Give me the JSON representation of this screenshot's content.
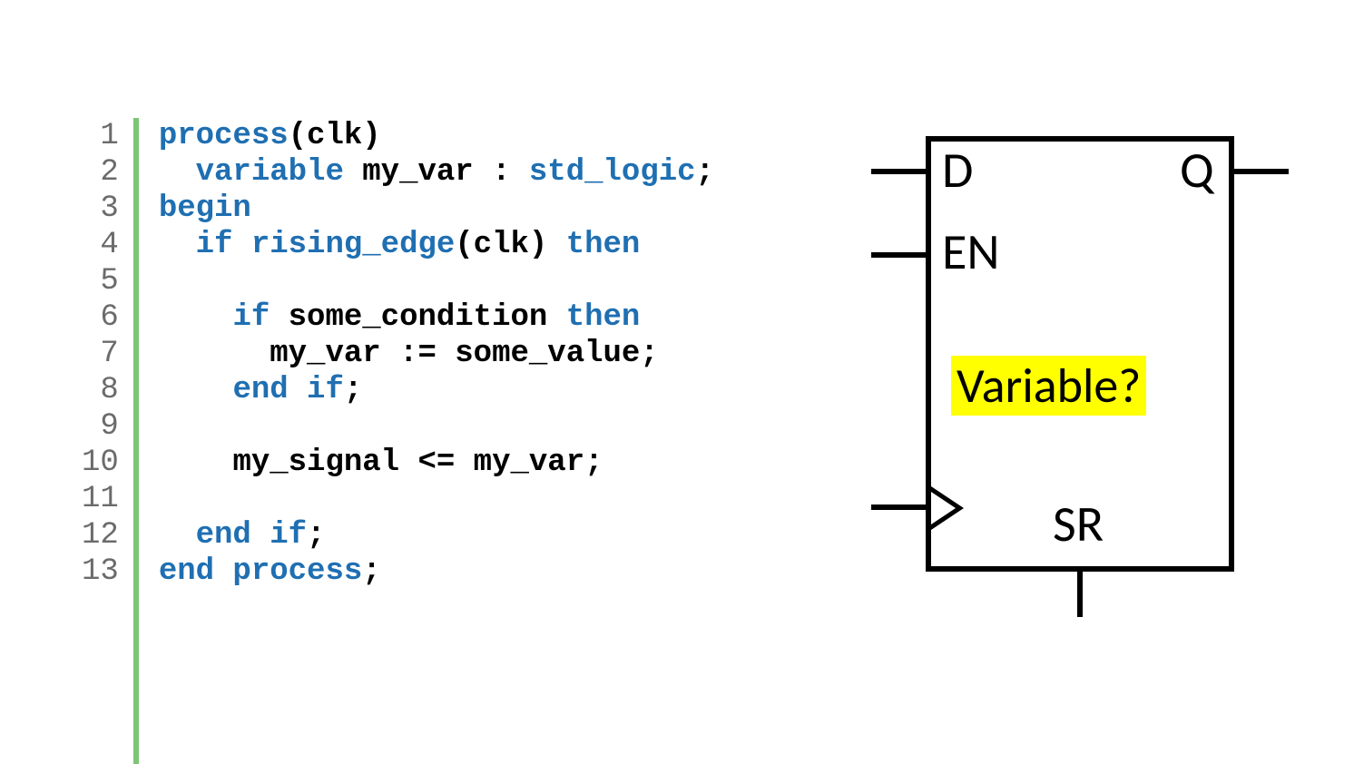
{
  "code": {
    "line_numbers": [
      "1",
      "2",
      "3",
      "4",
      "5",
      "6",
      "7",
      "8",
      "9",
      "10",
      "11",
      "12",
      "13"
    ],
    "lines": [
      {
        "indent": 0,
        "tokens": [
          {
            "t": "process",
            "c": "kw"
          },
          {
            "t": "(clk)",
            "c": "id"
          }
        ]
      },
      {
        "indent": 1,
        "tokens": [
          {
            "t": "variable",
            "c": "kw"
          },
          {
            "t": " my_var : ",
            "c": "id"
          },
          {
            "t": "std_logic",
            "c": "typ"
          },
          {
            "t": ";",
            "c": "op"
          }
        ]
      },
      {
        "indent": 0,
        "tokens": [
          {
            "t": "begin",
            "c": "kw"
          }
        ]
      },
      {
        "indent": 1,
        "tokens": [
          {
            "t": "if",
            "c": "kw"
          },
          {
            "t": " ",
            "c": "id"
          },
          {
            "t": "rising_edge",
            "c": "kw"
          },
          {
            "t": "(clk) ",
            "c": "id"
          },
          {
            "t": "then",
            "c": "kw"
          }
        ]
      },
      {
        "indent": 0,
        "tokens": []
      },
      {
        "indent": 2,
        "tokens": [
          {
            "t": "if",
            "c": "kw"
          },
          {
            "t": " some_condition ",
            "c": "id"
          },
          {
            "t": "then",
            "c": "kw"
          }
        ]
      },
      {
        "indent": 3,
        "tokens": [
          {
            "t": "my_var := some_value;",
            "c": "id"
          }
        ]
      },
      {
        "indent": 2,
        "tokens": [
          {
            "t": "end if",
            "c": "kw"
          },
          {
            "t": ";",
            "c": "op"
          }
        ]
      },
      {
        "indent": 0,
        "tokens": []
      },
      {
        "indent": 2,
        "tokens": [
          {
            "t": "my_signal <= my_var;",
            "c": "id"
          }
        ]
      },
      {
        "indent": 0,
        "tokens": []
      },
      {
        "indent": 1,
        "tokens": [
          {
            "t": "end if",
            "c": "kw"
          },
          {
            "t": ";",
            "c": "op"
          }
        ]
      },
      {
        "indent": 0,
        "tokens": [
          {
            "t": "end process",
            "c": "kw"
          },
          {
            "t": ";",
            "c": "op"
          }
        ]
      }
    ]
  },
  "diagram": {
    "labels": {
      "d": "D",
      "q": "Q",
      "en": "EN",
      "sr": "SR",
      "var": "Variable?"
    }
  }
}
